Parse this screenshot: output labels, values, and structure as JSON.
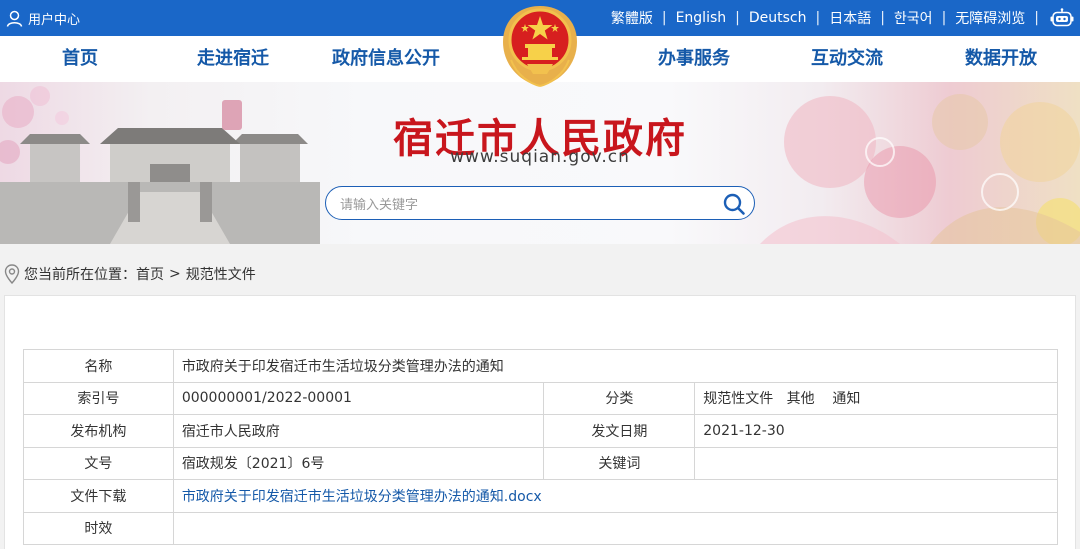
{
  "topbar": {
    "user_center": "用户中心",
    "languages": [
      "繁體版",
      "English",
      "Deutsch",
      "日本語",
      "한국어",
      "无障碍浏览"
    ],
    "separator": "|"
  },
  "nav": {
    "items": [
      "首页",
      "走进宿迁",
      "政府信息公开",
      "办事服务",
      "互动交流",
      "数据开放"
    ]
  },
  "banner": {
    "title": "宿迁市人民政府",
    "domain": "www.suqian.gov.cn",
    "search_placeholder": "请输入关键字"
  },
  "breadcrumb": {
    "prefix": "您当前所在位置：",
    "items": [
      "首页",
      "规范性文件"
    ],
    "separator": ">"
  },
  "info_table": {
    "name_label": "名称",
    "name_value": "市政府关于印发宿迁市生活垃圾分类管理办法的通知",
    "index_label": "索引号",
    "index_value": "000000001/2022-00001",
    "category_label": "分类",
    "category_value": "规范性文件   其他    通知",
    "issuer_label": "发布机构",
    "issuer_value": "宿迁市人民政府",
    "date_label": "发文日期",
    "date_value": "2021-12-30",
    "docno_label": "文号",
    "docno_value": "宿政规发〔2021〕6号",
    "keywords_label": "关键词",
    "keywords_value": "",
    "download_label": "文件下载",
    "download_value": "市政府关于印发宿迁市生活垃圾分类管理办法的通知.docx",
    "validity_label": "时效",
    "validity_value": ""
  },
  "colors": {
    "topbar_bg": "#1a67c8",
    "nav_text": "#1559a8",
    "title_red": "#c8161d",
    "search_border": "#1c5fb6"
  },
  "icons": [
    "user-icon",
    "robot-icon",
    "national-emblem",
    "search-icon",
    "location-pin-icon"
  ]
}
